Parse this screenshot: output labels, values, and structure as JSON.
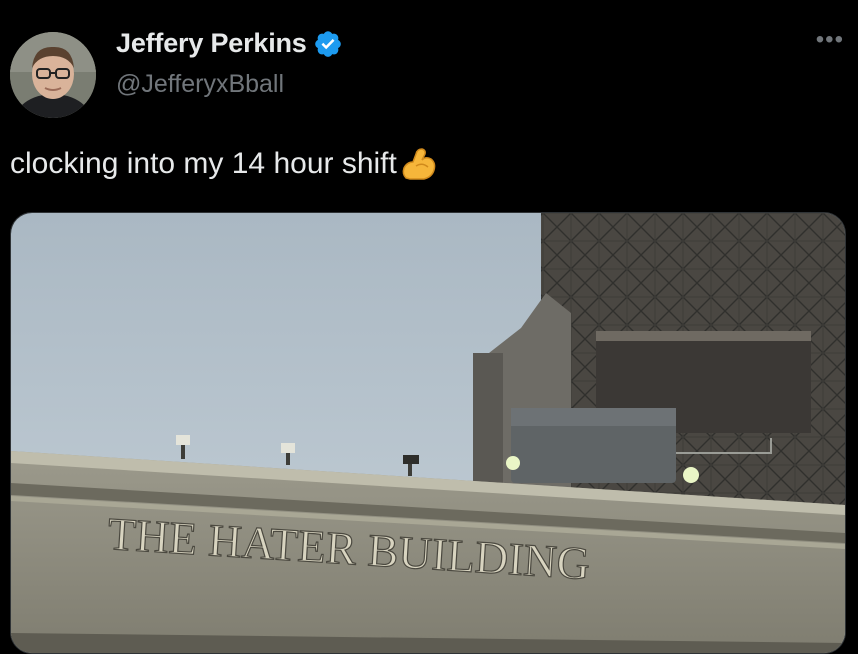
{
  "author": {
    "name": "Jeffery Perkins",
    "handle": "@JefferyxBball",
    "avatar_icon": "profile-photo",
    "verified_icon": "verified-badge-icon",
    "verified_color": "#1d9bf0"
  },
  "menu": {
    "more_label": "•••"
  },
  "tweet": {
    "text": "clocking into my 14 hour shift",
    "emoji": "flexed-biceps-icon"
  },
  "media": {
    "sign_text": "THE HATER BUILDING"
  }
}
